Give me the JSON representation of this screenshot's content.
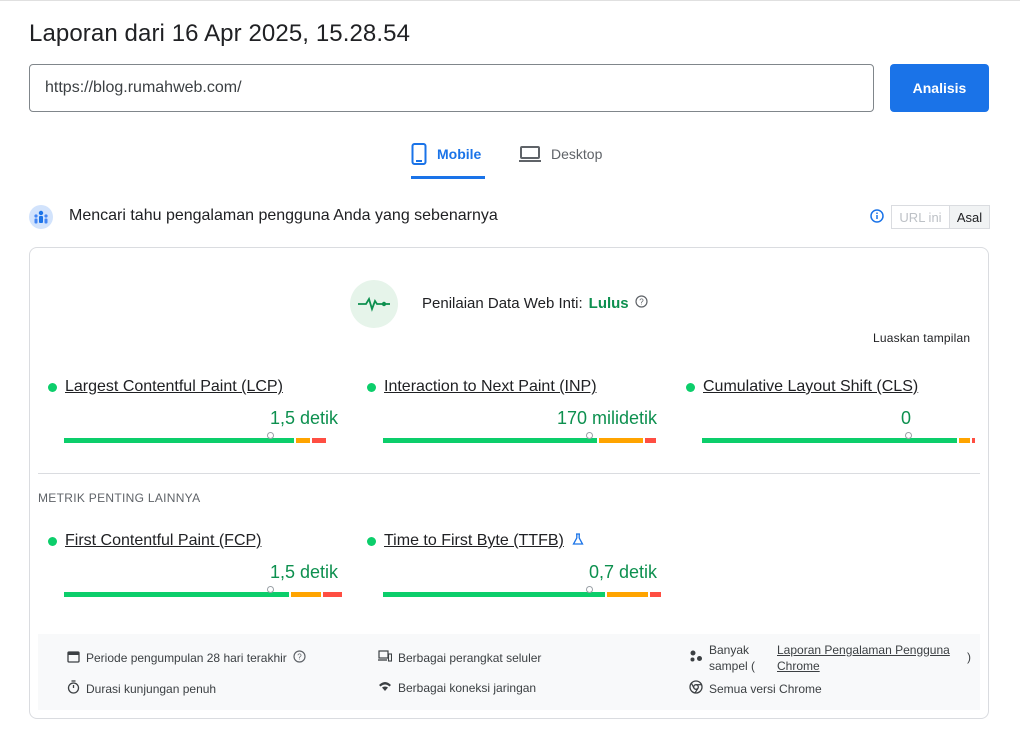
{
  "report_title": "Laporan dari 16 Apr 2025, 15.28.54",
  "url_input": {
    "value": "https://blog.rumahweb.com/"
  },
  "analyze_button": "Analisis",
  "tabs": {
    "mobile": "Mobile",
    "desktop": "Desktop",
    "active": "mobile"
  },
  "section_title": "Mencari tahu pengalaman pengguna Anda yang sebenarnya",
  "toggle": {
    "url": "URL ini",
    "origin": "Asal",
    "active": "origin"
  },
  "assessment": {
    "label": "Penilaian Data Web Inti:",
    "status": "Lulus"
  },
  "expand_link": "Luaskan tampilan",
  "core_metrics": [
    {
      "name": "Largest Contentful Paint (LCP)",
      "value": "1,5 detik",
      "status_color": "#0cce6b",
      "distribution": [
        0.84,
        0.05,
        0.05
      ]
    },
    {
      "name": "Interaction to Next Paint (INP)",
      "value": "170 milidetik",
      "status_color": "#0cce6b",
      "distribution": [
        0.78,
        0.16,
        0.04
      ]
    },
    {
      "name": "Cumulative Layout Shift (CLS)",
      "value": "0",
      "status_color": "#0cce6b",
      "distribution": [
        0.93,
        0.04,
        0.01
      ]
    }
  ],
  "other_title": "METRIK PENTING LAINNYA",
  "other_metrics": [
    {
      "name": "First Contentful Paint (FCP)",
      "value": "1,5 detik",
      "status_color": "#0cce6b",
      "distribution": [
        0.82,
        0.11,
        0.07
      ]
    },
    {
      "name": "Time to First Byte (TTFB)",
      "value": "0,7 detik",
      "status_color": "#0cce6b",
      "distribution": [
        0.81,
        0.15,
        0.04
      ],
      "experimental": true
    }
  ],
  "footer": {
    "period": "Periode pengumpulan 28 hari terakhir",
    "duration": "Durasi kunjungan penuh",
    "devices": "Berbagai perangkat seluler",
    "network": "Berbagai koneksi jaringan",
    "samples_prefix": "Banyak sampel (",
    "samples_link": "Laporan Pengalaman Pengguna Chrome",
    "samples_suffix": ")",
    "chrome": "Semua versi Chrome"
  },
  "colors": {
    "accent": "#1a73e8",
    "good": "#0cce6b",
    "good_text": "#0d904f",
    "needs_improvement": "#ffa400",
    "poor": "#ff4e42"
  },
  "icons": [
    "phone-icon",
    "laptop-icon",
    "users-icon",
    "info-icon",
    "heartbeat-icon",
    "help-icon",
    "flask-icon",
    "calendar-icon",
    "stopwatch-icon",
    "devices-icon",
    "wifi-icon",
    "samples-icon",
    "chrome-icon"
  ]
}
